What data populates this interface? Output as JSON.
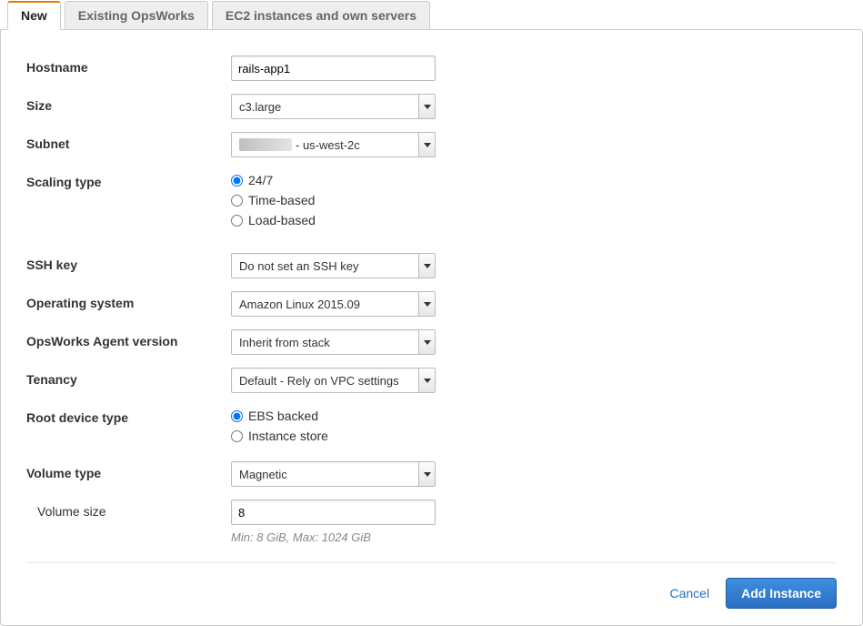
{
  "tabs": {
    "new": "New",
    "existing": "Existing OpsWorks",
    "ec2": "EC2 instances and own servers"
  },
  "labels": {
    "hostname": "Hostname",
    "size": "Size",
    "subnet": "Subnet",
    "scaling": "Scaling type",
    "ssh": "SSH key",
    "os": "Operating system",
    "agent": "OpsWorks Agent version",
    "tenancy": "Tenancy",
    "root": "Root device type",
    "voltype": "Volume type",
    "volsize": "Volume size"
  },
  "values": {
    "hostname": "rails-app1",
    "size": "c3.large",
    "subnet_suffix": " - us-west-2c",
    "ssh": "Do not set an SSH key",
    "os": "Amazon Linux 2015.09",
    "agent": "Inherit from stack",
    "tenancy": "Default - Rely on VPC settings",
    "voltype": "Magnetic",
    "volsize": "8"
  },
  "scaling_options": {
    "always": "24/7",
    "time": "Time-based",
    "load": "Load-based"
  },
  "root_options": {
    "ebs": "EBS backed",
    "instance": "Instance store"
  },
  "helper": {
    "volsize": "Min: 8 GiB, Max: 1024 GiB"
  },
  "actions": {
    "cancel": "Cancel",
    "add": "Add Instance"
  }
}
